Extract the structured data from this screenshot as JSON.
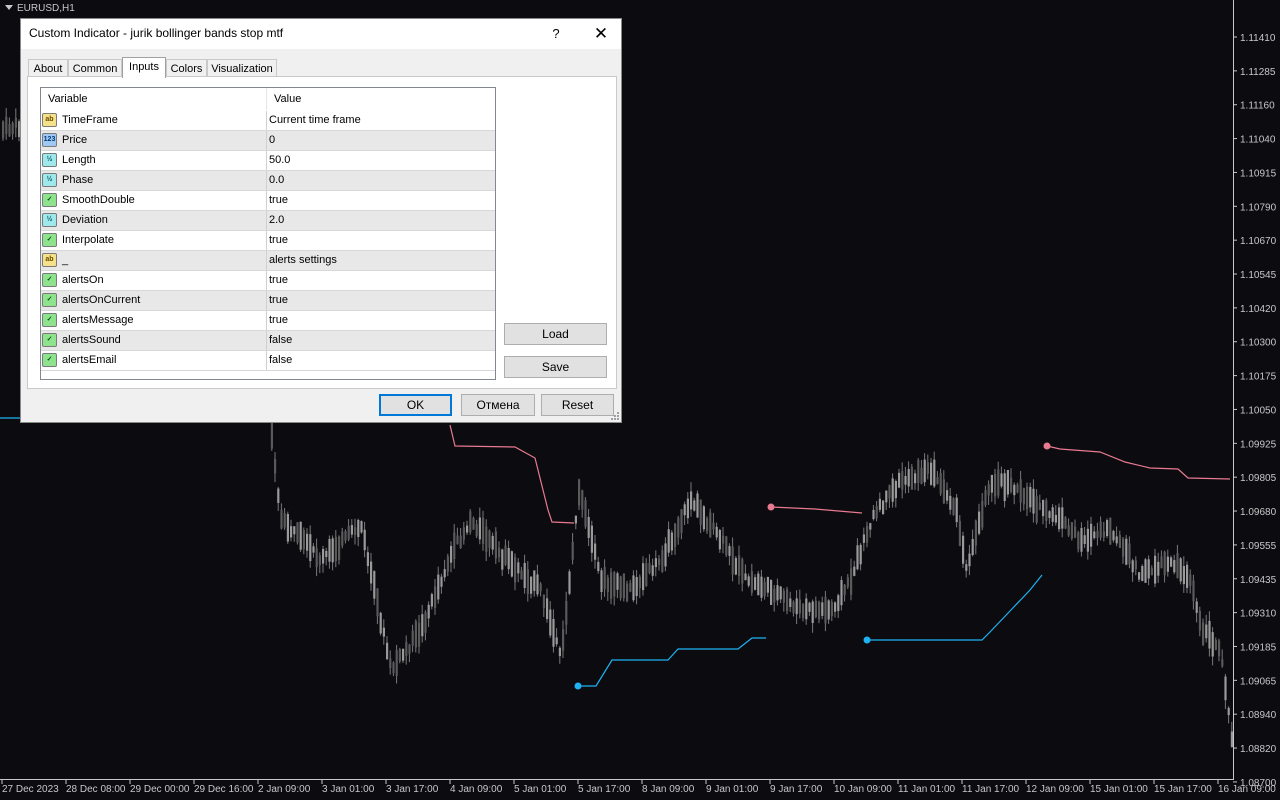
{
  "window": {
    "symbol": "EURUSD,H1"
  },
  "chart_data": {
    "type": "candlestick",
    "symbol": "EURUSD",
    "timeframe": "H1",
    "y_ticks": [
      "1.11410",
      "1.11285",
      "1.11160",
      "1.11040",
      "1.10915",
      "1.10790",
      "1.10670",
      "1.10545",
      "1.10420",
      "1.10300",
      "1.10175",
      "1.10050",
      "1.09925",
      "1.09805",
      "1.09680",
      "1.09555",
      "1.09435",
      "1.09310",
      "1.09185",
      "1.09065",
      "1.08940",
      "1.08820",
      "1.08700"
    ],
    "x_ticks": [
      "27 Dec 2023",
      "28 Dec 08:00",
      "29 Dec 00:00",
      "29 Dec 16:00",
      "2 Jan 09:00",
      "3 Jan 01:00",
      "3 Jan 17:00",
      "4 Jan 09:00",
      "5 Jan 01:00",
      "5 Jan 17:00",
      "8 Jan 09:00",
      "9 Jan 01:00",
      "9 Jan 17:00",
      "10 Jan 09:00",
      "11 Jan 01:00",
      "11 Jan 17:00",
      "12 Jan 09:00",
      "15 Jan 01:00",
      "15 Jan 17:00",
      "16 Jan 09:00"
    ],
    "colors": {
      "background": "#0b0b10",
      "candles": "#8c8c8c",
      "upper_stop": "#e87a90",
      "lower_stop": "#1fb2f2",
      "axis_text": "#c8c8c8"
    }
  },
  "dialog": {
    "title": "Custom Indicator - jurik bollinger bands stop mtf",
    "help": "?",
    "close": "✕",
    "tabs": [
      "About",
      "Common",
      "Inputs",
      "Colors",
      "Visualization"
    ],
    "active_tab": "Inputs",
    "grid": {
      "headers": [
        "Variable",
        "Value"
      ],
      "rows": [
        {
          "icon": "ab",
          "type": "string",
          "variable": "TimeFrame",
          "value": "Current time frame"
        },
        {
          "icon": "123",
          "type": "int",
          "variable": "Price",
          "value": "0"
        },
        {
          "icon": "½",
          "type": "double",
          "variable": "Length",
          "value": "50.0"
        },
        {
          "icon": "½",
          "type": "double",
          "variable": "Phase",
          "value": "0.0"
        },
        {
          "icon": "✓",
          "type": "bool",
          "variable": "SmoothDouble",
          "value": "true"
        },
        {
          "icon": "½",
          "type": "double",
          "variable": "Deviation",
          "value": "2.0"
        },
        {
          "icon": "✓",
          "type": "bool",
          "variable": "Interpolate",
          "value": "true"
        },
        {
          "icon": "ab",
          "type": "string",
          "variable": "_",
          "value": "alerts settings"
        },
        {
          "icon": "✓",
          "type": "bool",
          "variable": "alertsOn",
          "value": "true"
        },
        {
          "icon": "✓",
          "type": "bool",
          "variable": "alertsOnCurrent",
          "value": "true"
        },
        {
          "icon": "✓",
          "type": "bool",
          "variable": "alertsMessage",
          "value": "true"
        },
        {
          "icon": "✓",
          "type": "bool",
          "variable": "alertsSound",
          "value": "false"
        },
        {
          "icon": "✓",
          "type": "bool",
          "variable": "alertsEmail",
          "value": "false"
        }
      ]
    },
    "buttons": {
      "load": "Load",
      "save": "Save",
      "ok": "OK",
      "cancel": "Отмена",
      "reset": "Reset"
    }
  }
}
